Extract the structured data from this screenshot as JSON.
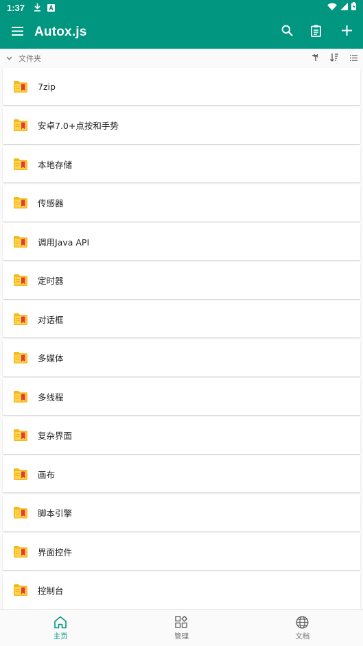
{
  "status_bar": {
    "time": "1:37",
    "icons_left": [
      "download-icon",
      "a-badge-icon"
    ],
    "icons_right": [
      "wifi-icon",
      "signal-icon",
      "battery-icon"
    ]
  },
  "app_bar": {
    "title": "Autox.js",
    "menu_icon": "hamburger-menu-icon",
    "actions": [
      "search-icon",
      "clipboard-icon",
      "add-icon"
    ]
  },
  "folder_header": {
    "label": "文件夹",
    "actions": [
      "sort-upward-icon",
      "sort-order-icon",
      "list-view-icon"
    ]
  },
  "folders": [
    {
      "name": "7zip"
    },
    {
      "name": "安卓7.0+点按和手势"
    },
    {
      "name": "本地存储"
    },
    {
      "name": "传感器"
    },
    {
      "name": "调用Java API"
    },
    {
      "name": "定时器"
    },
    {
      "name": "对话框"
    },
    {
      "name": "多媒体"
    },
    {
      "name": "多线程"
    },
    {
      "name": "复杂界面"
    },
    {
      "name": "画布"
    },
    {
      "name": "脚本引擎"
    },
    {
      "name": "界面控件"
    },
    {
      "name": "控制台"
    }
  ],
  "bottom_nav": {
    "tabs": [
      {
        "label": "主页",
        "icon": "home-icon",
        "active": true
      },
      {
        "label": "管理",
        "icon": "grid-manage-icon",
        "active": false
      },
      {
        "label": "文档",
        "icon": "globe-icon",
        "active": false
      }
    ]
  },
  "colors": {
    "primary": "#00967f",
    "folder_yellow": "#f5b81c",
    "folder_accent": "#e53935"
  }
}
